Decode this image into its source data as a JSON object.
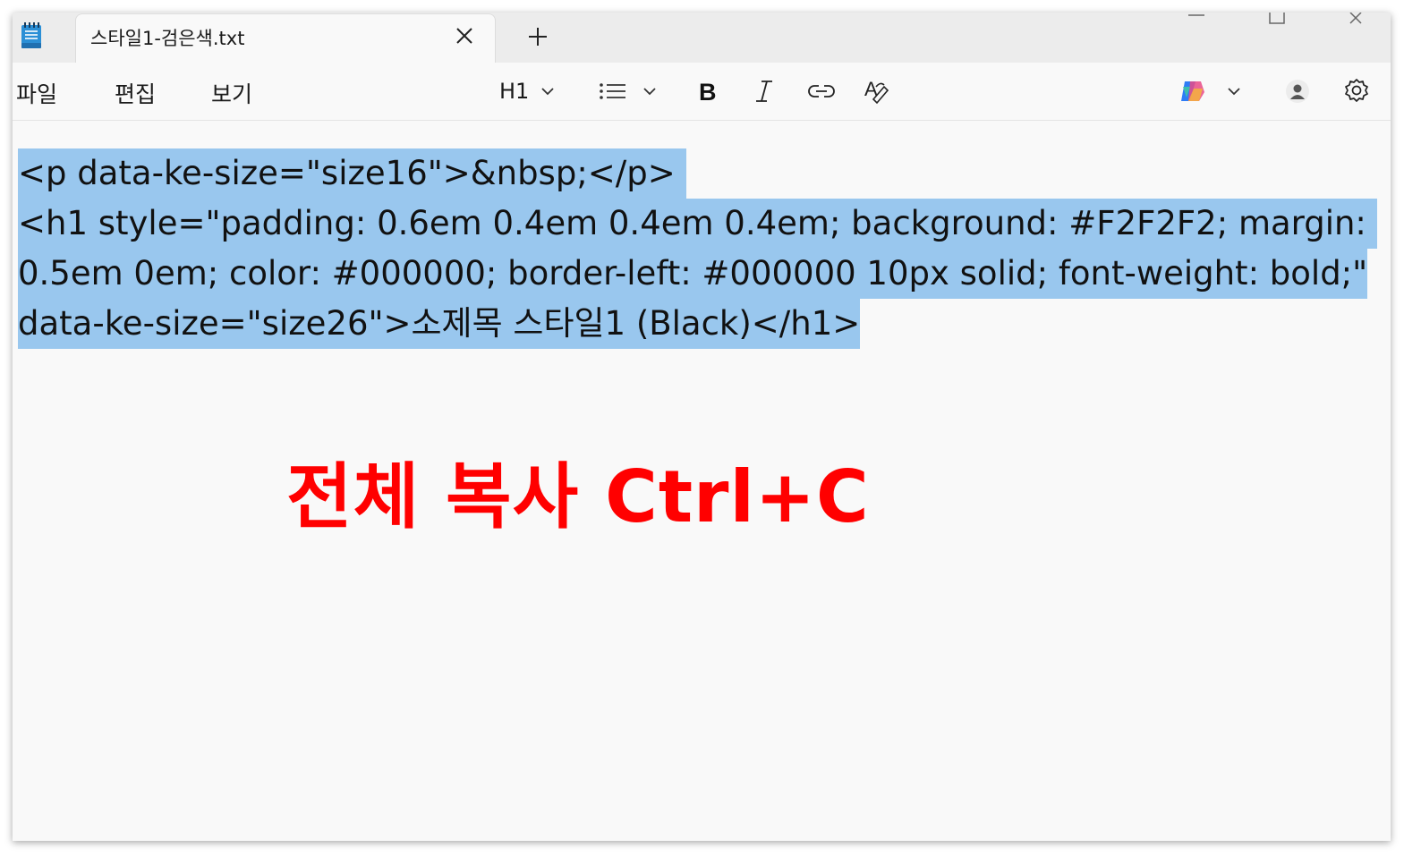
{
  "tab": {
    "title": "스타일1-검은색.txt"
  },
  "menu": {
    "file": "파일",
    "edit": "편집",
    "view": "보기"
  },
  "toolbar": {
    "heading": "H1",
    "icons": [
      "list-icon",
      "bold-icon",
      "italic-icon",
      "link-icon",
      "spellcheck-icon",
      "copilot-icon",
      "account-icon",
      "settings-icon"
    ]
  },
  "document": {
    "lines": [
      "<p data-ke-size=\"size16\">&nbsp;</p> ",
      "<h1 style=\"padding: 0.6em 0.4em 0.4em 0.4em; background: #F2F2F2; margin: ",
      "0.5em 0em; color: #000000; border-left: #000000 10px solid; font-weight: bold;\"",
      "data-ke-size=\"size26\">소제목 스타일1 (Black)</h1>"
    ],
    "selection_color": "#99c7ee"
  },
  "annotation": {
    "text": "전체 복사 Ctrl+C",
    "color": "#ff0000"
  }
}
